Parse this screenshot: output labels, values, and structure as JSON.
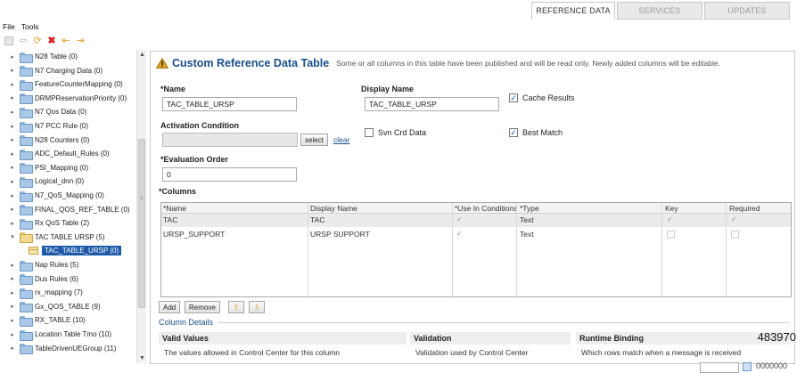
{
  "tabs": [
    {
      "label": "REFERENCE DATA",
      "active": true
    },
    {
      "label": "SERVICES",
      "active": false
    },
    {
      "label": "UPDATES",
      "active": false
    }
  ],
  "menu": {
    "file": "File",
    "tools": "Tools"
  },
  "toolbar": {
    "icons": [
      "lock-icon",
      "arrow-left-icon",
      "refresh-icon",
      "delete-icon",
      "import-icon",
      "export-icon"
    ]
  },
  "tree": {
    "items": [
      {
        "label": "N28 Table (0)"
      },
      {
        "label": "N7 Charging Data (0)"
      },
      {
        "label": "FeatureCounterMapping (0)"
      },
      {
        "label": "DRMPReservationPriority (0)"
      },
      {
        "label": "N7 Qos Data (0)"
      },
      {
        "label": "N7 PCC Rule (0)"
      },
      {
        "label": "N28 Counters (0)"
      },
      {
        "label": "ADC_Default_Rules (0)"
      },
      {
        "label": "PSI_Mapping (0)"
      },
      {
        "label": "Logical_dnn (0)"
      },
      {
        "label": "N7_QoS_Mapping (0)"
      },
      {
        "label": "FINAL_QOS_REF_TABLE (0)"
      },
      {
        "label": "Rx QoS Table (2)"
      },
      {
        "label": "TAC TABLE URSP (5)"
      },
      {
        "label": "TAC_TABLE_URSP (0)"
      },
      {
        "label": "Nap Rules (5)"
      },
      {
        "label": "Dus Rules (6)"
      },
      {
        "label": "rx_mapping (7)"
      },
      {
        "label": "Gx_QOS_TABLE (9)"
      },
      {
        "label": "RX_TABLE (10)"
      },
      {
        "label": "Location Table Tmo (10)"
      },
      {
        "label": "TableDrivenUEGroup (11)"
      }
    ]
  },
  "panel": {
    "title": "Custom Reference Data Table",
    "note": "Some or all columns in this table have been published and will be read only.  Newly added columns will be editable.",
    "name_label": "*Name",
    "name_value": "TAC_TABLE_URSP",
    "display_name_label": "Display Name",
    "display_name_value": "TAC_TABLE_URSP",
    "cache_results_label": "Cache Results",
    "cache_results_checked": true,
    "activation_label": "Activation Condition",
    "activation_value": "",
    "select_label": "select",
    "clear_label": "clear",
    "svn_label": "Svn Crd Data",
    "svn_checked": false,
    "best_match_label": "Best Match",
    "best_match_checked": true,
    "eval_label": "*Evaluation Order",
    "eval_value": "0",
    "columns_label": "*Columns"
  },
  "columns_table": {
    "headers": [
      "*Name",
      "Display Name",
      "*Use In Conditions",
      "*Type",
      "Key",
      "Required"
    ],
    "rows": [
      {
        "name": "TAC",
        "display": "TAC",
        "use_in_conditions": true,
        "type": "Text",
        "key": true,
        "required": true
      },
      {
        "name": "URSP_SUPPORT",
        "display": "URSP SUPPORT",
        "use_in_conditions": true,
        "type": "Text",
        "key": false,
        "required": false
      }
    ]
  },
  "buttons": {
    "add": "Add",
    "remove": "Remove",
    "up_icon": "arrow-up-icon",
    "down_icon": "arrow-down-icon"
  },
  "details": {
    "section_label": "Column Details",
    "valid_values_title": "Valid Values",
    "valid_values_text": "The values allowed in Control Center for this column",
    "validation_title": "Validation",
    "validation_text": "Validation used by Control Center",
    "runtime_title": "Runtime Binding",
    "runtime_text": "Which rows match when a message is received"
  },
  "doc_id": "483970",
  "status_value": "0000000",
  "colors": {
    "accent": "#1a4f8a",
    "selected": "#1e5aa8",
    "warning": "#e2a21a"
  }
}
